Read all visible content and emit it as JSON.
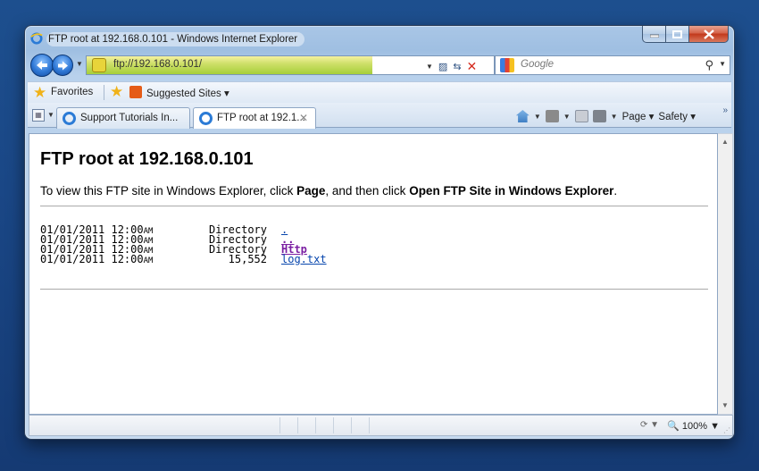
{
  "window": {
    "title": "FTP root at 192.168.0.101 - Windows Internet Explorer",
    "controls": {
      "minimize": "–",
      "maximize": "□",
      "close": "X"
    }
  },
  "address": {
    "url": "ftp://192.168.0.101/",
    "search_placeholder": "Google"
  },
  "favorites_bar": {
    "favorites_label": "Favorites",
    "suggested_label": "Suggested Sites ▾"
  },
  "tabs": [
    {
      "label": "Support Tutorials In...",
      "active": false
    },
    {
      "label": "FTP root at 192.1...",
      "active": true,
      "close": "✕"
    }
  ],
  "command_bar": {
    "page_label": "Page ▾",
    "safety_label": "Safety ▾"
  },
  "page": {
    "title": "FTP root at 192.168.0.101",
    "instruction_pre": "To view this FTP site in Windows Explorer, click ",
    "instruction_page": "Page",
    "instruction_mid": ", and then click ",
    "instruction_open": "Open FTP Site in Windows Explorer",
    "instruction_end": ".",
    "listing": [
      {
        "date": "01/01/2011 12:00",
        "ampm": "AM",
        "type": "Directory",
        "name": "."
      },
      {
        "date": "01/01/2011 12:00",
        "ampm": "AM",
        "type": "Directory",
        "name": ".."
      },
      {
        "date": "01/01/2011 12:00",
        "ampm": "AM",
        "type": "Directory",
        "name": "Http"
      },
      {
        "date": "01/01/2011 12:00",
        "ampm": "AM",
        "type": "15,552",
        "name": "log.txt"
      }
    ]
  },
  "statusbar": {
    "zoom": "100%"
  },
  "colors": {
    "desktop": "#1a4786",
    "link": "#0645ad",
    "visited_link": "#7b1fa2",
    "address_highlight": "#a6cf3a"
  }
}
